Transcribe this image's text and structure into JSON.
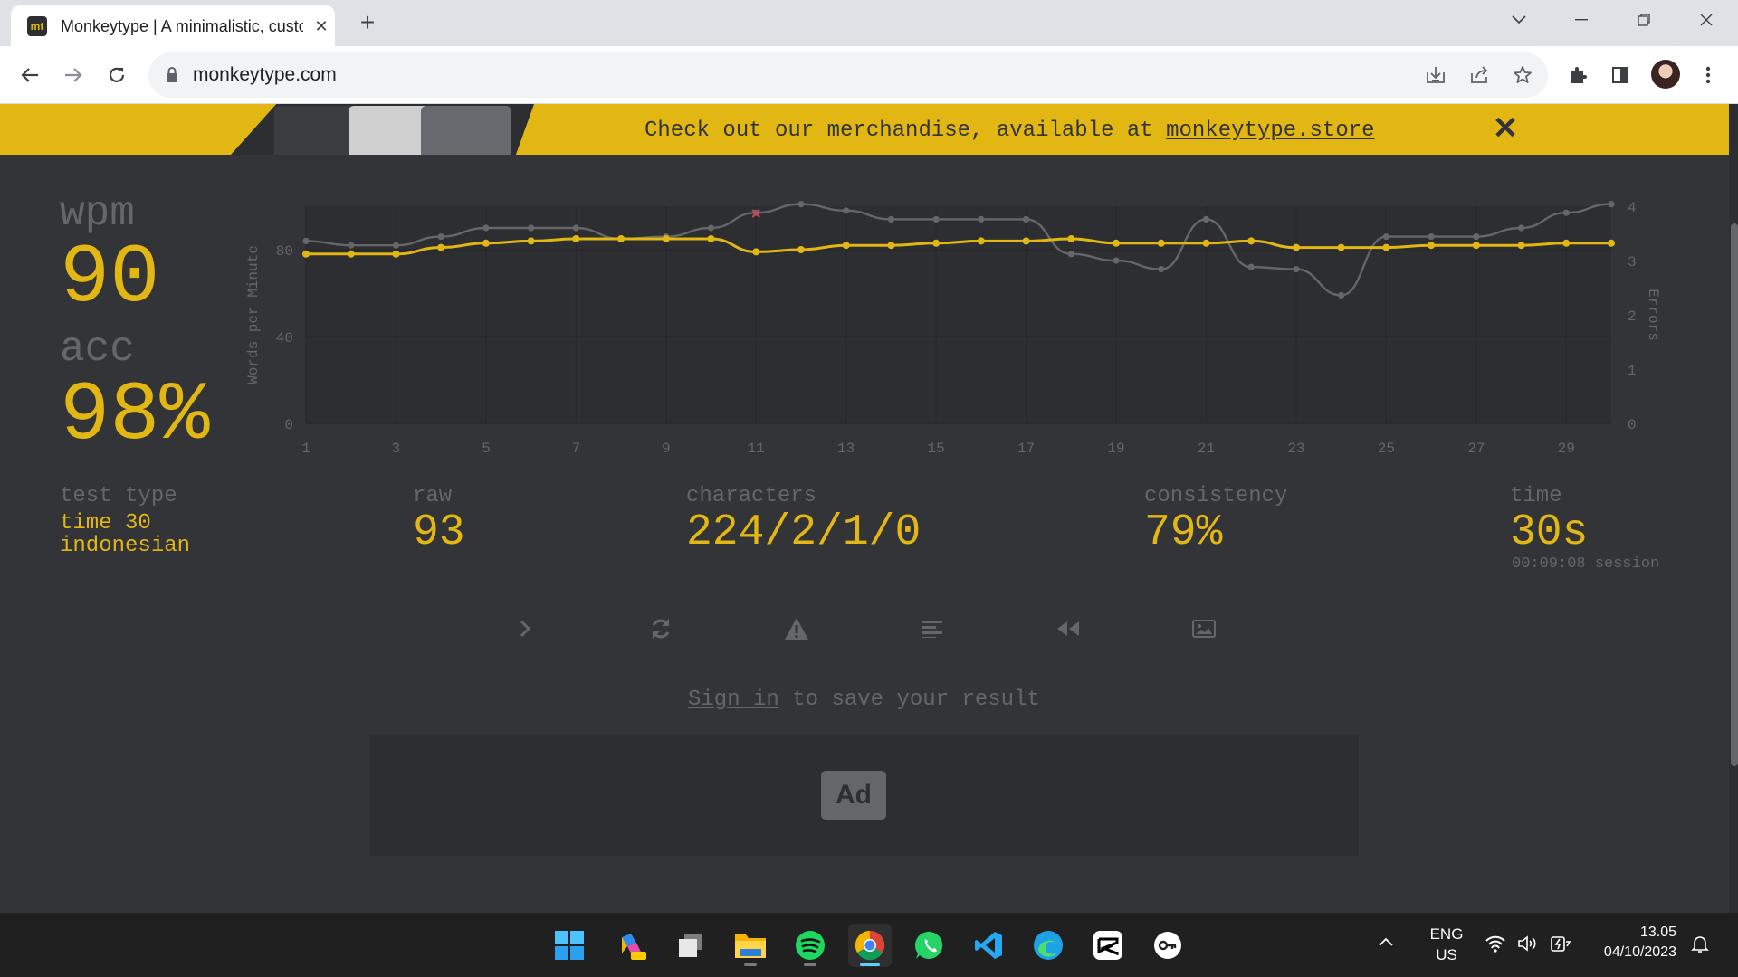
{
  "browser": {
    "tab_title": "Monkeytype | A minimalistic, customizable typing test",
    "tab_favicon": "mt",
    "url": "monkeytype.com"
  },
  "banner": {
    "text": "Check out our merchandise, available at ",
    "link": "monkeytype.store",
    "close": "✕"
  },
  "results": {
    "wpm_label": "wpm",
    "wpm": "90",
    "acc_label": "acc",
    "acc": "98%",
    "test_type_label": "test type",
    "test_type_line1": "time 30",
    "test_type_line2": "indonesian",
    "raw_label": "raw",
    "raw": "93",
    "characters_label": "characters",
    "characters": "224/2/1/0",
    "consistency_label": "consistency",
    "consistency": "79%",
    "time_label": "time",
    "time": "30s",
    "session": "00:09:08 session"
  },
  "signin": {
    "link": "Sign in",
    "text": " to save your result"
  },
  "ad": {
    "label": "Ad"
  },
  "chart_data": {
    "type": "line",
    "ylabel": "Words per Minute",
    "y2label": "Errors",
    "ylim": [
      0,
      100
    ],
    "y2lim": [
      0,
      4
    ],
    "yticks": [
      0,
      40,
      80
    ],
    "y2ticks": [
      0,
      1,
      2,
      3,
      4
    ],
    "x": [
      1,
      2,
      3,
      4,
      5,
      6,
      7,
      8,
      9,
      10,
      11,
      12,
      13,
      14,
      15,
      16,
      17,
      18,
      19,
      20,
      21,
      22,
      23,
      24,
      25,
      26,
      27,
      28,
      29,
      30
    ],
    "xticks": [
      1,
      3,
      5,
      7,
      9,
      11,
      13,
      15,
      17,
      19,
      21,
      23,
      25,
      27,
      29
    ],
    "series": [
      {
        "name": "wpm",
        "color": "#e2b714",
        "values": [
          78,
          78,
          78,
          81,
          83,
          84,
          85,
          85,
          85,
          85,
          79,
          80,
          82,
          82,
          83,
          84,
          84,
          85,
          83,
          83,
          83,
          84,
          81,
          81,
          81,
          82,
          82,
          82,
          83,
          83
        ]
      },
      {
        "name": "raw",
        "color": "#646669",
        "values": [
          84,
          82,
          82,
          86,
          90,
          90,
          90,
          85,
          86,
          90,
          97,
          101,
          98,
          94,
          94,
          94,
          94,
          78,
          75,
          71,
          94,
          72,
          71,
          59,
          86,
          86,
          86,
          90,
          97,
          101
        ]
      }
    ],
    "errors": [
      {
        "x": 11,
        "value": 1
      }
    ],
    "grid": true
  },
  "taskbar": {
    "lang1": "ENG",
    "lang2": "US",
    "time": "13.05",
    "date": "04/10/2023"
  },
  "colors": {
    "bg": "#323437",
    "main": "#e2b714",
    "sub": "#646669",
    "error": "#ca4754"
  }
}
